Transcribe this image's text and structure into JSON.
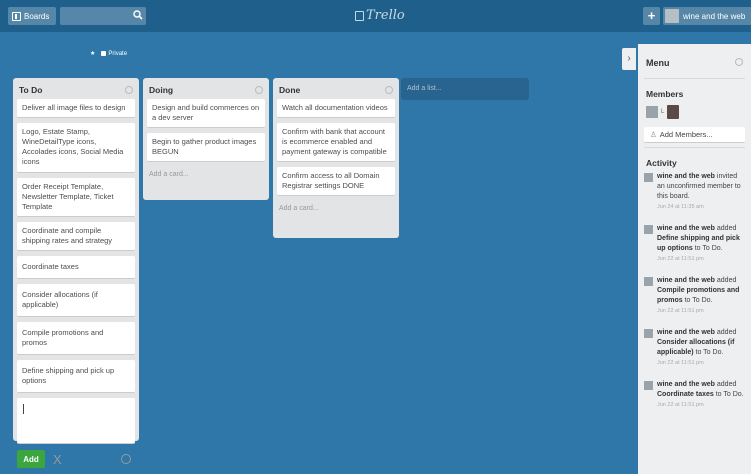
{
  "header": {
    "boards_label": "Boards",
    "logo_text": "Trello",
    "plus_label": "+",
    "user_label": "wine and the web"
  },
  "board": {
    "star": "★",
    "privacy": "Private"
  },
  "lists": [
    {
      "title": "To Do",
      "cards": [
        "Deliver all image files to design",
        "Logo, Estate Stamp, WineDetailType icons, Accolades icons, Social Media icons",
        "Order Receipt Template, Newsletter Template, Ticket Template",
        "Coordinate and compile shipping rates and strategy",
        "Coordinate taxes",
        "Consider allocations (if applicable)",
        "Compile promotions and promos",
        "Define shipping and pick up options"
      ],
      "add_button": "Add",
      "cancel": "X"
    },
    {
      "title": "Doing",
      "cards": [
        "Design and build commerces on a dev server",
        "Begin to gather product images BEGUN"
      ],
      "add_card": "Add a card..."
    },
    {
      "title": "Done",
      "cards": [
        "Watch all documentation videos",
        "Confirm with bank that account is ecommerce enabled and payment gateway is compatible",
        "Confirm access to all Domain Registrar settings DONE"
      ],
      "add_card": "Add a card..."
    }
  ],
  "add_list": "Add a list...",
  "sidebar": {
    "title": "Menu",
    "members_title": "Members",
    "member_initial": "L",
    "add_members": "Add Members...",
    "activity_title": "Activity",
    "activities": [
      {
        "actor": "wine and the web",
        "text": " invited an unconfirmed member to this board.",
        "when": "Jun 24 at 11:35 am"
      },
      {
        "actor": "wine and the web",
        "text": " added ",
        "bold": "Define shipping and pick up options",
        "tail": " to To Do.",
        "when": "Jun 22 at 11:51 pm"
      },
      {
        "actor": "wine and the web",
        "text": " added ",
        "bold": "Compile promotions and promos",
        "tail": " to To Do.",
        "when": "Jun 22 at 11:51 pm"
      },
      {
        "actor": "wine and the web",
        "text": " added ",
        "bold": "Consider allocations (if applicable)",
        "tail": " to To Do.",
        "when": "Jun 22 at 11:51 pm"
      },
      {
        "actor": "wine and the web",
        "text": " added ",
        "bold": "Coordinate taxes",
        "tail": " to To Do.",
        "when": "Jun 22 at 11:51 pm"
      }
    ]
  }
}
